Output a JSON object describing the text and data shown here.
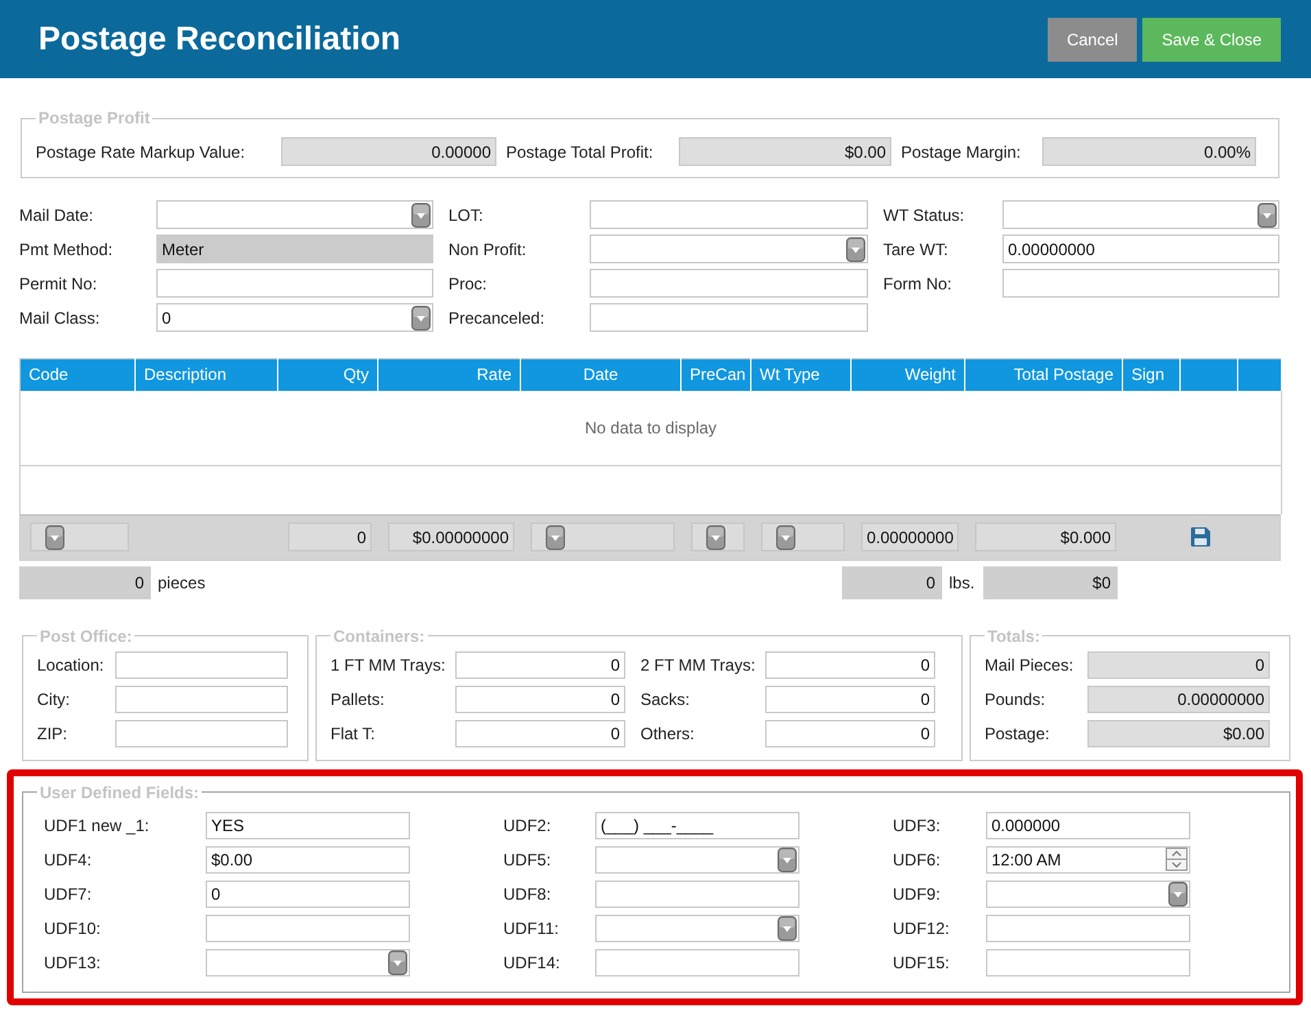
{
  "header": {
    "title": "Postage Reconciliation",
    "buttons": [
      {
        "label": "Cancel",
        "kind": "secondary"
      },
      {
        "label": "Save & Close",
        "kind": "primary"
      }
    ]
  },
  "postage_profit": {
    "legend": "Postage Profit",
    "fields": [
      {
        "label": "Postage Rate Markup Value:",
        "kind": "readonly",
        "value": "0.00000"
      },
      {
        "label": "Postage Total Profit:",
        "kind": "readonly",
        "value": "$0.00"
      },
      {
        "label": "Postage Margin:",
        "kind": "readonly",
        "value": "0.00%"
      }
    ]
  },
  "mailing": {
    "fields": [
      {
        "label": "Mail Date:",
        "kind": "select"
      },
      {
        "label": "LOT:",
        "kind": "text"
      },
      {
        "label": "WT Status:",
        "kind": "select"
      },
      {
        "label": "Pmt Method:",
        "kind": "locked",
        "value": "Meter"
      },
      {
        "label": "Non Profit:",
        "kind": "select"
      },
      {
        "label": "Tare WT:",
        "kind": "text",
        "value": "0.00000000"
      },
      {
        "label": "Permit No:",
        "kind": "text"
      },
      {
        "label": "Proc:",
        "kind": "text"
      },
      {
        "label": "Form No:",
        "kind": "text"
      },
      {
        "label": "Mail Class:",
        "kind": "select",
        "value": "0"
      },
      {
        "label": "Precanceled:",
        "kind": "text"
      }
    ]
  },
  "grid": {
    "columns": [
      "Code",
      "Description",
      "Qty",
      "Rate",
      "Date",
      "PreCan",
      "Wt Type",
      "Weight",
      "Total Postage",
      "Sign"
    ],
    "empty_message": "No data to display",
    "entry_row": [
      {
        "kind": "select"
      },
      {
        "kind": "blank"
      },
      {
        "kind": "readonly",
        "value": "0"
      },
      {
        "kind": "readonly",
        "value": "$0.00000000"
      },
      {
        "kind": "select"
      },
      {
        "kind": "select"
      },
      {
        "kind": "select"
      },
      {
        "kind": "readonly",
        "value": "0.00000000"
      },
      {
        "kind": "readonly",
        "value": "$0.000"
      },
      {
        "kind": "blank"
      },
      {
        "kind": "save"
      },
      {
        "kind": "blank"
      }
    ]
  },
  "summary": [
    {
      "value": "0",
      "unit": "pieces"
    },
    {
      "value": "0",
      "unit": "lbs."
    },
    {
      "value": "$0"
    }
  ],
  "post_office": {
    "legend": "Post Office:",
    "fields": [
      {
        "label": "Location:",
        "kind": "text"
      },
      {
        "label": "City:",
        "kind": "text"
      },
      {
        "label": "ZIP:",
        "kind": "text"
      }
    ]
  },
  "containers": {
    "legend": "Containers:",
    "fields": [
      {
        "label": "1 FT MM Trays:",
        "kind": "number",
        "value": "0"
      },
      {
        "label": "2 FT MM Trays:",
        "kind": "number",
        "value": "0"
      },
      {
        "label": "Pallets:",
        "kind": "number",
        "value": "0"
      },
      {
        "label": "Sacks:",
        "kind": "number",
        "value": "0"
      },
      {
        "label": "Flat T:",
        "kind": "number",
        "value": "0"
      },
      {
        "label": "Others:",
        "kind": "number",
        "value": "0"
      }
    ]
  },
  "totals": {
    "legend": "Totals:",
    "fields": [
      {
        "label": "Mail Pieces:",
        "kind": "readonly",
        "value": "0"
      },
      {
        "label": "Pounds:",
        "kind": "readonly",
        "value": "0.00000000"
      },
      {
        "label": "Postage:",
        "kind": "readonly",
        "value": "$0.00"
      }
    ]
  },
  "user_defined_fields": {
    "legend": "User Defined Fields:",
    "highlighted": true,
    "fields": [
      {
        "label": "UDF1 new _1:",
        "kind": "text",
        "value": "YES"
      },
      {
        "label": "UDF2:",
        "kind": "text",
        "value": "(___) ___-____"
      },
      {
        "label": "UDF3:",
        "kind": "text",
        "value": "0.000000"
      },
      {
        "label": "UDF4:",
        "kind": "text",
        "value": "$0.00"
      },
      {
        "label": "UDF5:",
        "kind": "select"
      },
      {
        "label": "UDF6:",
        "kind": "time",
        "value": "12:00 AM"
      },
      {
        "label": "UDF7:",
        "kind": "text",
        "value": "0"
      },
      {
        "label": "UDF8:",
        "kind": "text"
      },
      {
        "label": "UDF9:",
        "kind": "select"
      },
      {
        "label": "UDF10:",
        "kind": "text"
      },
      {
        "label": "UDF11:",
        "kind": "select"
      },
      {
        "label": "UDF12:",
        "kind": "text"
      },
      {
        "label": "UDF13:",
        "kind": "select"
      },
      {
        "label": "UDF14:",
        "kind": "text"
      },
      {
        "label": "UDF15:",
        "kind": "text"
      }
    ]
  }
}
